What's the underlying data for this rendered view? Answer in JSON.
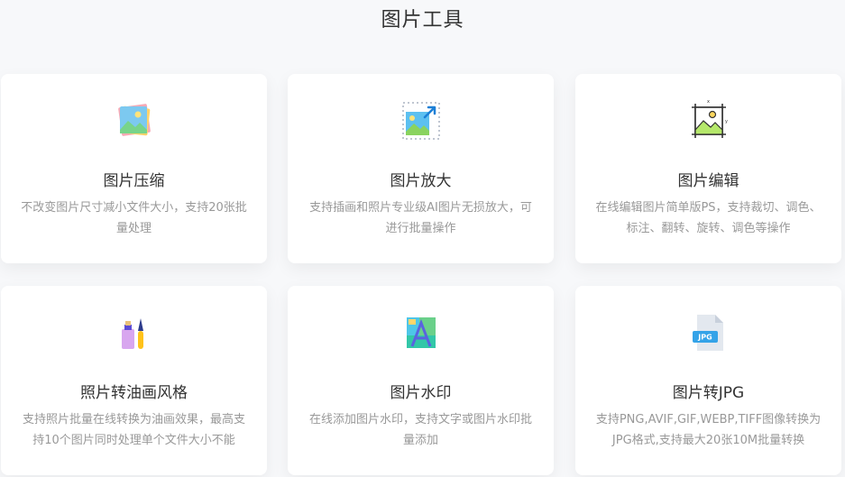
{
  "page": {
    "title": "图片工具"
  },
  "tools": [
    {
      "title": "图片压缩",
      "desc": "不改变图片尺寸减小文件大小，支持20张批量处理",
      "icon": "image-compress-icon"
    },
    {
      "title": "图片放大",
      "desc": "支持插画和照片专业级AI图片无损放大，可进行批量操作",
      "icon": "image-enlarge-icon"
    },
    {
      "title": "图片编辑",
      "desc": "在线编辑图片简单版PS，支持裁切、调色、标注、翻转、旋转、调色等操作",
      "icon": "image-edit-icon"
    },
    {
      "title": "照片转油画风格",
      "desc": "支持照片批量在线转换为油画效果，最高支持10个图片同时处理单个文件大小不能",
      "icon": "paint-brush-icon"
    },
    {
      "title": "图片水印",
      "desc": "在线添加图片水印，支持文字或图片水印批量添加",
      "icon": "image-watermark-icon"
    },
    {
      "title": "图片转JPG",
      "desc": "支持PNG,AVIF,GIF,WEBP,TIFF图像转换为JPG格式,支持最大20张10M批量转换",
      "icon": "jpg-file-icon",
      "badge": "JPG"
    }
  ]
}
